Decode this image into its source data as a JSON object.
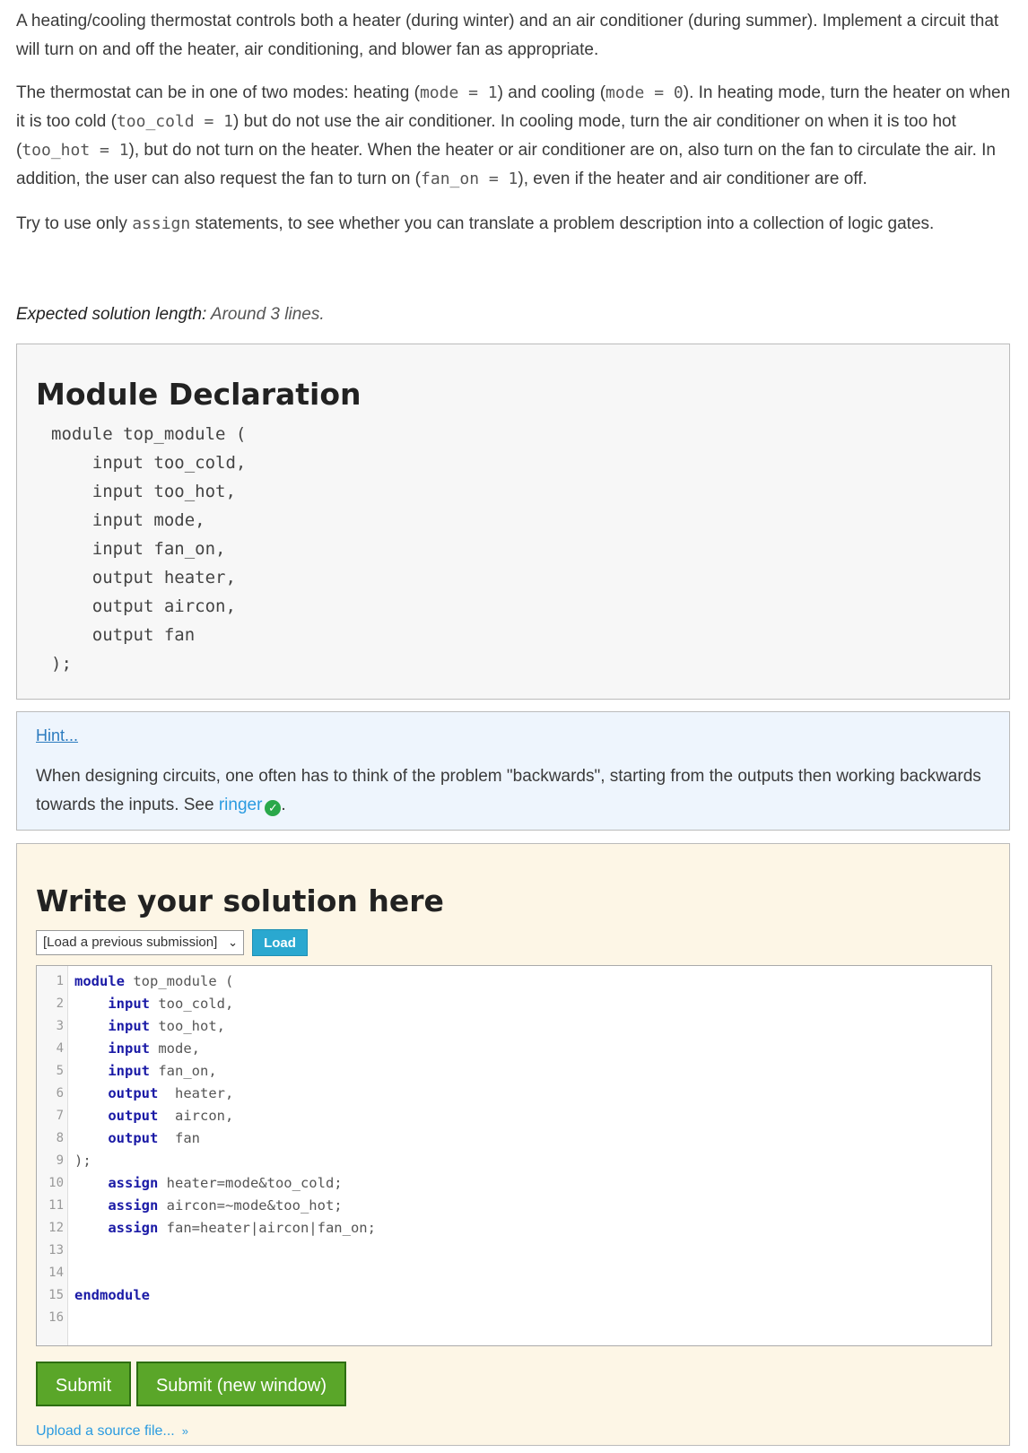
{
  "intro": {
    "p1": "A heating/cooling thermostat controls both a heater (during winter) and an air conditioner (during summer). Implement a circuit that will turn on and off the heater, air conditioning, and blower fan as appropriate.",
    "p2_a": "The thermostat can be in one of two modes: heating (",
    "p2_code1": "mode = 1",
    "p2_b": ") and cooling (",
    "p2_code2": "mode = 0",
    "p2_c": "). In heating mode, turn the heater on when it is too cold (",
    "p2_code3": "too_cold = 1",
    "p2_d": ") but do not use the air conditioner. In cooling mode, turn the air conditioner on when it is too hot (",
    "p2_code4": "too_hot = 1",
    "p2_e": "), but do not turn on the heater. When the heater or air conditioner are on, also turn on the fan to circulate the air. In addition, the user can also request the fan to turn on (",
    "p2_code5": "fan_on = 1",
    "p2_f": "), even if the heater and air conditioner are off.",
    "p3_a": "Try to use only ",
    "p3_code": "assign",
    "p3_b": " statements, to see whether you can translate a problem description into a collection of logic gates."
  },
  "expected": {
    "label": "Expected solution length:",
    "value": "Around 3 lines."
  },
  "declaration": {
    "title": "Module Declaration",
    "code": "module top_module (\n    input too_cold,\n    input too_hot,\n    input mode,\n    input fan_on,\n    output heater,\n    output aircon,\n    output fan\n);"
  },
  "hint": {
    "link": "Hint...",
    "text": "When designing circuits, one often has to think of the problem \"backwards\", starting from the outputs then working backwards towards the inputs. See ",
    "ringer": "ringer",
    "after": "."
  },
  "solution": {
    "title": "Write your solution here",
    "select_value": "[Load a previous submission]",
    "load_label": "Load",
    "lines": [
      {
        "n": "1",
        "kw": "module",
        "rest": " top_module ("
      },
      {
        "n": "2",
        "indent": "    ",
        "kw": "input",
        "rest": " too_cold,"
      },
      {
        "n": "3",
        "indent": "    ",
        "kw": "input",
        "rest": " too_hot,"
      },
      {
        "n": "4",
        "indent": "    ",
        "kw": "input",
        "rest": " mode,"
      },
      {
        "n": "5",
        "indent": "    ",
        "kw": "input",
        "rest": " fan_on,"
      },
      {
        "n": "6",
        "indent": "    ",
        "kw": "output",
        "rest": "  heater,"
      },
      {
        "n": "7",
        "indent": "    ",
        "kw": "output",
        "rest": "  aircon,"
      },
      {
        "n": "8",
        "indent": "    ",
        "kw": "output",
        "rest": "  fan"
      },
      {
        "n": "9",
        "kw": "",
        "rest": ");"
      },
      {
        "n": "10",
        "indent": "    ",
        "kw": "assign",
        "rest": " heater=mode&too_cold;"
      },
      {
        "n": "11",
        "indent": "    ",
        "kw": "assign",
        "rest": " aircon=~mode&too_hot;"
      },
      {
        "n": "12",
        "indent": "    ",
        "kw": "assign",
        "rest": " fan=heater|aircon|fan_on;"
      },
      {
        "n": "13",
        "kw": "",
        "rest": ""
      },
      {
        "n": "14",
        "kw": "",
        "rest": ""
      },
      {
        "n": "15",
        "kw": "endmodule",
        "rest": ""
      },
      {
        "n": "16",
        "kw": "",
        "rest": ""
      }
    ],
    "submit_label": "Submit",
    "submit_new_label": "Submit (new window)",
    "upload_label": "Upload a source file..."
  }
}
